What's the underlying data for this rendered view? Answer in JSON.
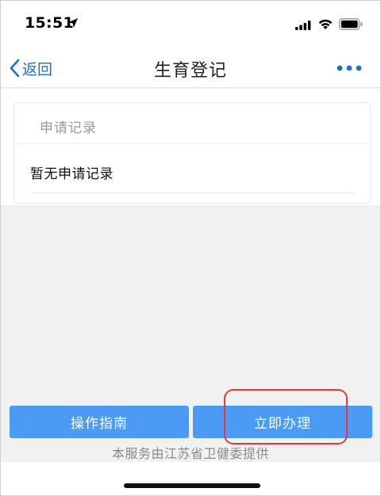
{
  "status_bar": {
    "time": "15:51",
    "icons": [
      "location-arrow-icon",
      "cellular-signal-icon",
      "wifi-icon",
      "battery-icon"
    ]
  },
  "nav": {
    "back_label": "返回",
    "title": "生育登记",
    "more_icon": "more-dots-icon",
    "accent_color": "#1a73c9"
  },
  "records": {
    "header": "申请记录",
    "empty_text": "暂无申请记录"
  },
  "actions": {
    "guide_label": "操作指南",
    "apply_label": "立即办理",
    "button_color": "#4b9bf5",
    "highlight_color": "#e53935"
  },
  "footer": {
    "provider_text": "本服务由江苏省卫健委提供"
  }
}
